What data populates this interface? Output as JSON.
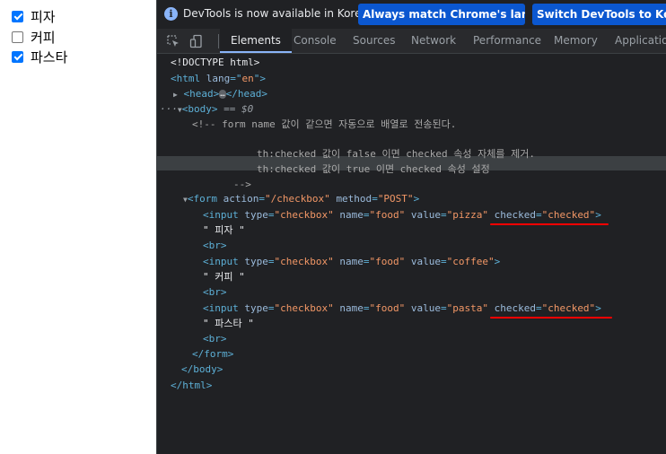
{
  "page": {
    "checkboxes": [
      {
        "label": "피자",
        "checked": true
      },
      {
        "label": "커피",
        "checked": false
      },
      {
        "label": "파스타",
        "checked": true
      }
    ]
  },
  "infobar": {
    "text": "DevTools is now available in Korean!",
    "match_button": "Always match Chrome's language",
    "switch_button": "Switch DevTools to Korean"
  },
  "tabs": [
    "Elements",
    "Console",
    "Sources",
    "Network",
    "Performance",
    "Memory",
    "Application"
  ],
  "active_tab": "Elements",
  "code": {
    "doctype": "<!DOCTYPE html>",
    "html_open_tag": "<html",
    "lang_attr": "lang",
    "lang_eq": "=\"",
    "lang_val": "en",
    "lang_close": "\">",
    "head_open": "<head>",
    "head_dots": "…",
    "head_close": "</head>",
    "body_open": "<body>",
    "body_eq": " == ",
    "body_var": "$0",
    "comment_1": "<!-- form name 값이 같으면 자동으로 배열로 전송된다.",
    "comment_2": "th:checked 값이 false 이면 checked 속성 자체를 제거.",
    "comment_3": "th:checked 값이 true 이면 checked 속성 설정",
    "comment_end": "-->",
    "form_tag": "<form",
    "form_action_attr": "action",
    "form_action_val": "\"/checkbox\"",
    "form_method_attr": "method",
    "form_method_val": "\"POST\"",
    "gt": ">",
    "input_tag": "<input",
    "type_attr": "type",
    "type_val": "\"checkbox\"",
    "name_attr": "name",
    "name_val": "\"food\"",
    "value_attr": "value",
    "value_pizza": "\"pizza\"",
    "value_coffee": "\"coffee\"",
    "value_pasta": "\"pasta\"",
    "checked_attr": "checked",
    "checked_val": "\"checked\"",
    "eq": "=",
    "text_pizza": "\" 피자 \"",
    "text_coffee": "\" 커피 \"",
    "text_pasta": "\" 파스타 \"",
    "br": "<br>",
    "form_close": "</form>",
    "body_close": "</body>",
    "html_close": "</html>"
  },
  "colors": {
    "annotation_underline": "#ff0000",
    "info_button_bg": "#0b57d0"
  },
  "icons": [
    "info-icon",
    "inspect-element-icon",
    "device-toolbar-icon",
    "expand-triangle-icon",
    "collapse-triangle-icon",
    "ellipsis-icon"
  ]
}
